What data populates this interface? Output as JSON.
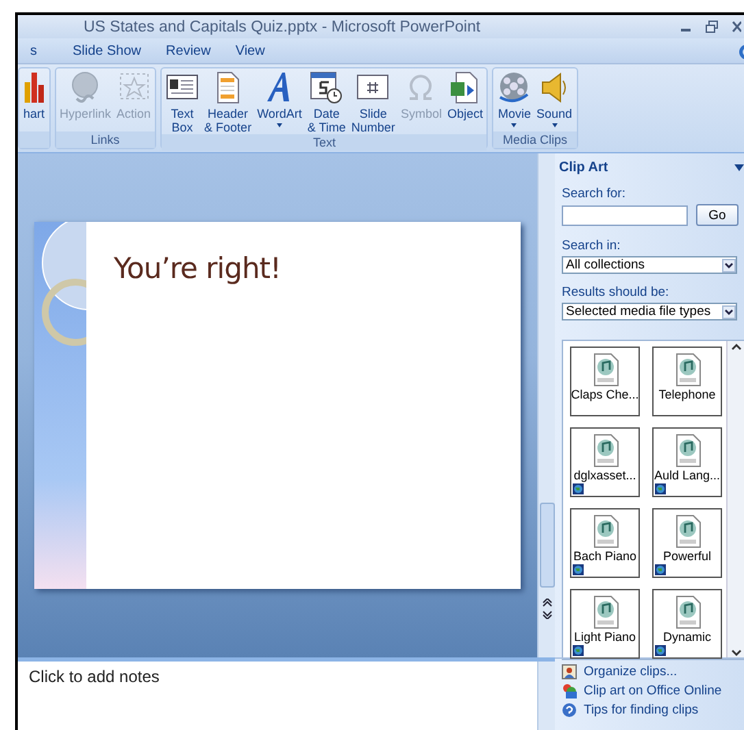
{
  "window": {
    "title": "US States and Capitals Quiz.pptx - Microsoft PowerPoint"
  },
  "tabs": [
    {
      "label": "s",
      "selected": false
    },
    {
      "label": "Slide Show",
      "selected": false
    },
    {
      "label": "Review",
      "selected": false
    },
    {
      "label": "View",
      "selected": false
    }
  ],
  "ribbon": {
    "groups": [
      {
        "buttons": [
          {
            "label": "hart",
            "disabled": false,
            "dropdown": false
          }
        ]
      },
      {
        "label": "Links",
        "buttons": [
          {
            "label": "Hyperlink",
            "disabled": true,
            "dropdown": false
          },
          {
            "label": "Action",
            "disabled": true,
            "dropdown": false
          }
        ]
      },
      {
        "label": "Text",
        "buttons": [
          {
            "label": "Text\nBox",
            "disabled": false,
            "dropdown": false
          },
          {
            "label": "Header\n& Footer",
            "disabled": false,
            "dropdown": false
          },
          {
            "label": "WordArt",
            "disabled": false,
            "dropdown": true
          },
          {
            "label": "Date\n& Time",
            "disabled": false,
            "dropdown": false
          },
          {
            "label": "Slide\nNumber",
            "disabled": false,
            "dropdown": false
          },
          {
            "label": "Symbol",
            "disabled": true,
            "dropdown": false
          },
          {
            "label": "Object",
            "disabled": false,
            "dropdown": false
          }
        ]
      },
      {
        "label": "Media Clips",
        "buttons": [
          {
            "label": "Movie",
            "disabled": false,
            "dropdown": true
          },
          {
            "label": "Sound",
            "disabled": false,
            "dropdown": true
          }
        ]
      }
    ]
  },
  "slide": {
    "title": "You’re right!"
  },
  "notes": {
    "placeholder": "Click to add notes"
  },
  "clip_art": {
    "title": "Clip Art",
    "search_label": "Search for:",
    "go_button": "Go",
    "search_in_label": "Search in:",
    "search_in": "All collections",
    "results_label": "Results should be:",
    "results": "Selected media file types",
    "clips": [
      {
        "label": "Claps Che...",
        "online": false
      },
      {
        "label": "Telephone",
        "online": false
      },
      {
        "label": "dglxasset...",
        "online": true
      },
      {
        "label": "Auld Lang...",
        "online": true
      },
      {
        "label": "Bach Piano",
        "online": true
      },
      {
        "label": "Powerful",
        "online": true
      },
      {
        "label": "Light Piano",
        "online": true
      },
      {
        "label": "Dynamic",
        "online": true
      }
    ],
    "links": [
      "Organize clips...",
      "Clip art on Office Online",
      "Tips for finding clips"
    ]
  }
}
